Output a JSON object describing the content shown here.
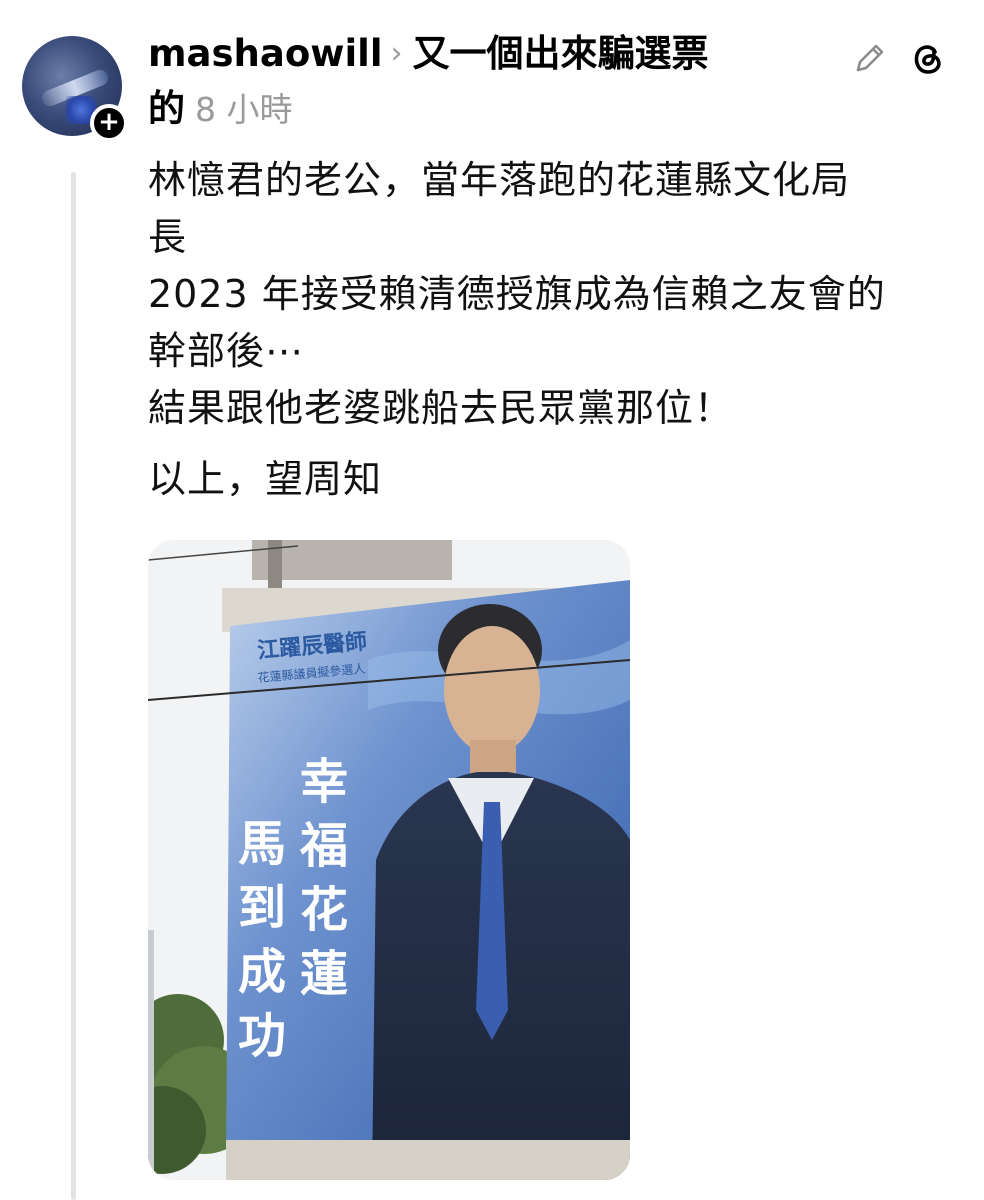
{
  "post": {
    "username": "mashaowill",
    "chevron": "›",
    "topic": "又一個出來騙選票的",
    "topic_line1": "又一個出來騙選票",
    "topic_line2": "的",
    "time": "8 小時",
    "body_lines": [
      "林憶君的老公，當年落跑的花蓮縣文化局",
      "長",
      "2023 年接受賴清德授旗成為信賴之友會的",
      "幹部後⋯",
      "結果跟他老婆跳船去民眾黨那位！",
      "",
      "以上，望周知"
    ]
  },
  "billboard": {
    "name": "江躍辰醫師",
    "subtitle": "花蓮縣議員擬參選人",
    "slogan1": "幸福花蓮",
    "slogan2": "馬到成功"
  },
  "icons": {
    "follow": "plus-icon",
    "edit": "pencil-icon",
    "app": "threads-icon"
  },
  "colors": {
    "text": "#000000",
    "muted": "#9a9a9a",
    "thread_line": "#e3e3e3",
    "billboard_blue": "#2f5aa8"
  }
}
